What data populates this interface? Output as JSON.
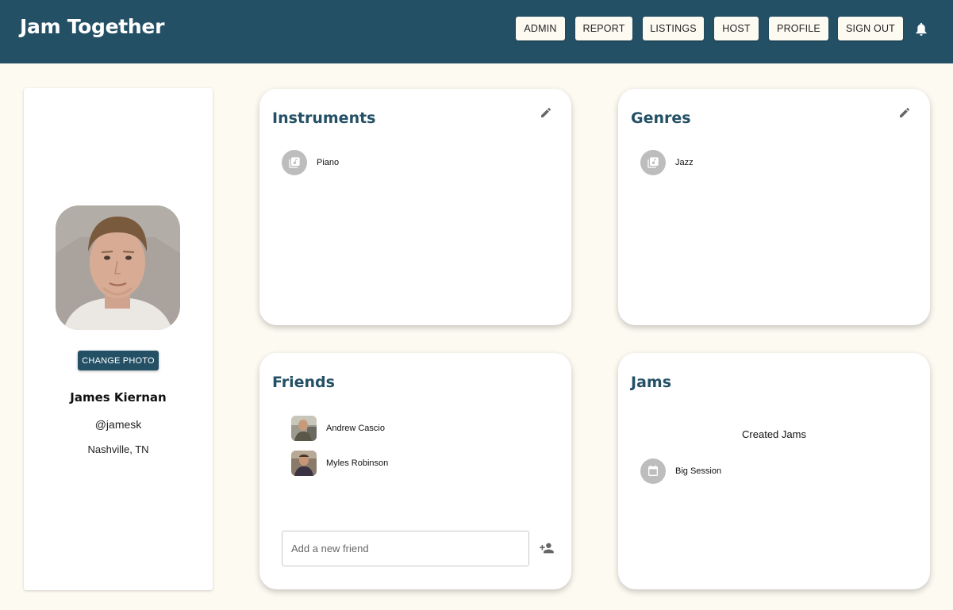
{
  "header": {
    "brand": "Jam Together",
    "nav": [
      "ADMIN",
      "REPORT",
      "LISTINGS",
      "HOST",
      "PROFILE",
      "SIGN OUT"
    ],
    "notification_icon": "bell-icon"
  },
  "profile": {
    "change_photo_label": "CHANGE PHOTO",
    "name": "James Kiernan",
    "handle": "@jamesk",
    "location": "Nashville, TN"
  },
  "instruments": {
    "title": "Instruments",
    "items": [
      {
        "label": "Piano",
        "icon": "music-library-icon"
      }
    ]
  },
  "genres": {
    "title": "Genres",
    "items": [
      {
        "label": "Jazz",
        "icon": "music-library-icon"
      }
    ]
  },
  "friends": {
    "title": "Friends",
    "items": [
      {
        "name": "Andrew Cascio"
      },
      {
        "name": "Myles Robinson"
      }
    ],
    "add_placeholder": "Add a new friend",
    "add_icon": "person-add-icon"
  },
  "jams": {
    "title": "Jams",
    "subtitle": "Created Jams",
    "items": [
      {
        "label": "Big Session",
        "icon": "calendar-icon"
      }
    ]
  },
  "colors": {
    "primary": "#245066",
    "background": "#fdfaf2",
    "icon_circle": "#bdbdbd"
  }
}
